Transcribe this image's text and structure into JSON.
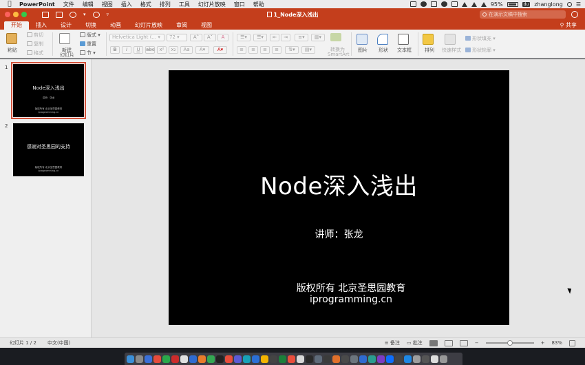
{
  "menubar": {
    "app_name": "PowerPoint",
    "items": [
      "文件",
      "编辑",
      "视图",
      "插入",
      "格式",
      "排列",
      "工具",
      "幻灯片放映",
      "窗口",
      "帮助"
    ],
    "battery": "95%",
    "username": "zhanglong",
    "user_badge": "du"
  },
  "window": {
    "title": "1_Node深入浅出",
    "search_placeholder": "在演示文稿中搜索"
  },
  "ribbon_tabs": [
    "开始",
    "插入",
    "设计",
    "切换",
    "动画",
    "幻灯片放映",
    "审阅",
    "视图"
  ],
  "share_label": "共享",
  "ribbon": {
    "paste": "粘贴",
    "cut": "剪切",
    "copy": "复制",
    "format": "格式",
    "new_slide_line1": "新建",
    "new_slide_line2": "幻灯片",
    "layout": "版式",
    "reset": "重置",
    "section": "节",
    "font_name": "Helvetica Light (...",
    "font_size": "72",
    "convert_line1": "转换为",
    "convert_line2": "SmartArt",
    "picture": "图片",
    "shape": "形状",
    "textbox": "文本框",
    "arrange": "排列",
    "quick_styles": "快速样式",
    "shape_fill": "形状填充",
    "shape_outline": "形状轮廓"
  },
  "thumbnails": [
    {
      "number": "1",
      "title": "Node深入浅出",
      "subtitle": "讲师：张龙",
      "footer1": "版权所有  北京圣思园教育",
      "footer2": "iprogramming.cn"
    },
    {
      "number": "2",
      "title": "感谢对圣思园的支持",
      "footer1": "版权所有  北京圣思园教育",
      "footer2": "iprogramming.cn"
    }
  ],
  "slide": {
    "title": "Node深入浅出",
    "speaker": "讲师：张龙",
    "copyright": "版权所有  北京圣思园教育",
    "site": "iprogramming.cn"
  },
  "statusbar": {
    "slide_position": "幻灯片 1 / 2",
    "language": "中文(中国)",
    "notes": "备注",
    "comments": "批注",
    "zoom": "83%",
    "zoom_level": 0.5
  }
}
